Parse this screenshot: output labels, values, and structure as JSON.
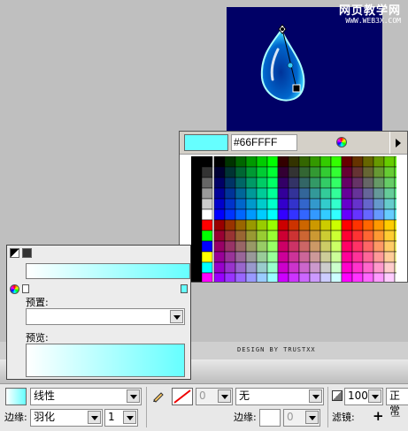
{
  "watermark": {
    "site": "网页教学网",
    "url": "WWW.WEB3X.COM"
  },
  "swatch_panel": {
    "hex_value": "#66FFFF",
    "selected_color": "#66ffff",
    "color_wheel_icon": "color-wheel-icon",
    "menu_arrow_icon": "panel-menu-arrow-icon"
  },
  "credit": "DESIGN BY TRUSTXX",
  "fill_panel": {
    "preset_label": "预置:",
    "preset_value": "",
    "preview_label": "预览:",
    "gradient_start": "#ffffff",
    "gradient_end": "#66ffff"
  },
  "properties": {
    "fill_type": "线性",
    "edge_label": "边缘:",
    "edge_value": "羽化",
    "edge_amount": "1",
    "stroke_size": "0",
    "stroke_type": "无",
    "stroke_edge_label": "边缘:",
    "stroke_edge_amount": "0",
    "opacity": "100",
    "blend_mode": "正常",
    "filters_label": "滤镜:",
    "add_filter": "+",
    "remove_filter": "−"
  }
}
